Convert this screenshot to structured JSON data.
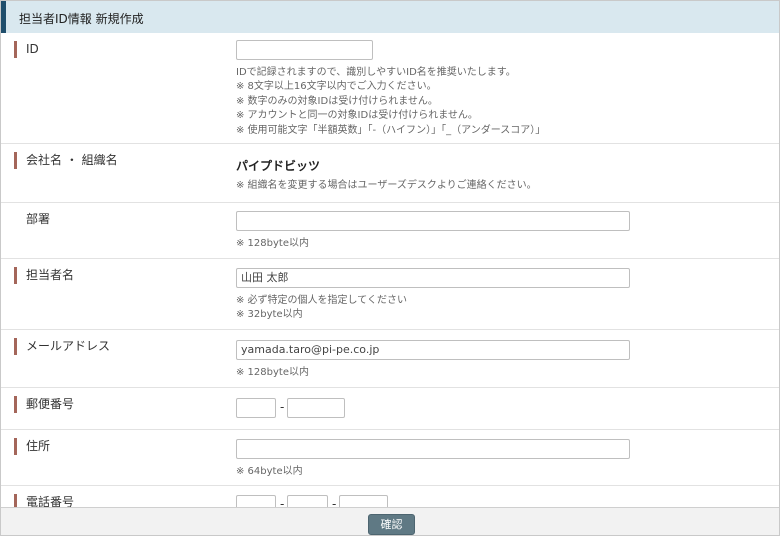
{
  "header": {
    "title": "担当者ID情報 新規作成"
  },
  "fields": {
    "id": {
      "label": "ID",
      "value": "",
      "notes": [
        "IDで記録されますので、識別しやすいID名を推奨いたします。",
        "※ 8文字以上16文字以内でご入力ください。",
        "※ 数字のみの対象IDは受け付けられません。",
        "※ アカウントと同一の対象IDは受け付けられません。",
        "※ 使用可能文字「半額英数」「-（ハイフン）」「_（アンダースコア）」"
      ]
    },
    "company": {
      "label": "会社名 ・ 組織名",
      "value": "パイプドビッツ",
      "note": "※ 組織名を変更する場合はユーザーズデスクよりご連絡ください。"
    },
    "department": {
      "label": "部署",
      "value": "",
      "note": "※ 128byte以内"
    },
    "person": {
      "label": "担当者名",
      "placeholder": "山田 太郎",
      "notes": [
        "※ 必ず特定の個人を指定してください",
        "※ 32byte以内"
      ]
    },
    "email": {
      "label": "メールアドレス",
      "placeholder": "yamada.taro@pi-pe.co.jp",
      "note": "※ 128byte以内"
    },
    "postal": {
      "label": "郵便番号",
      "separator": "-"
    },
    "address": {
      "label": "住所",
      "value": "",
      "note": "※ 64byte以内"
    },
    "phone": {
      "label": "電話番号",
      "separator": "-"
    }
  },
  "footer": {
    "confirm_label": "確認"
  },
  "colors": {
    "header_bg": "#d9e8ef",
    "header_accent": "#1f4e6c",
    "label_marker": "#a4665a",
    "button_bg": "#5f7984"
  }
}
